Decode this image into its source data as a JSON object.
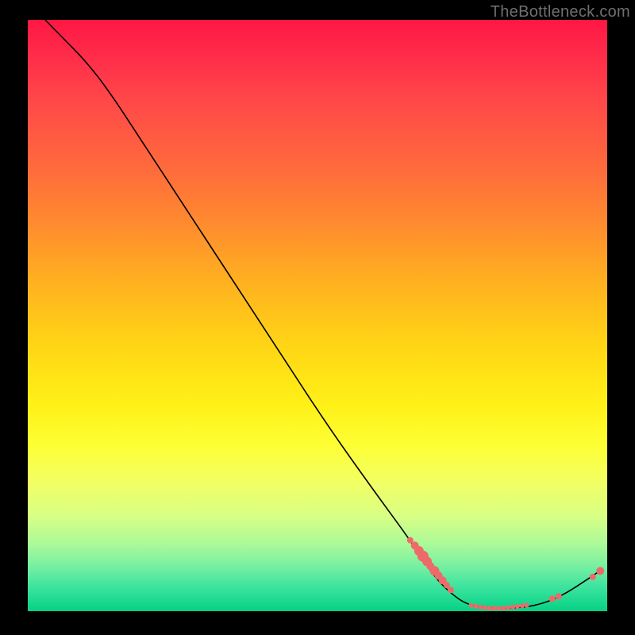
{
  "watermark": "TheBottleneck.com",
  "colors": {
    "background": "#000000",
    "curve": "#000000",
    "dot": "#ee6a6a",
    "watermark": "#6f6f6f",
    "gradient_top": "#ff1744",
    "gradient_mid": "#fff017",
    "gradient_bottom": "#08cf84"
  },
  "chart_data": {
    "type": "line",
    "title": "",
    "xlabel": "",
    "ylabel": "",
    "xlim": [
      0,
      100
    ],
    "ylim": [
      0,
      100
    ],
    "legend": false,
    "grid": false,
    "note": "Y axis is inverted visually: high value = high bottleneck = red top; minimum sits near bottom-right before rising again.",
    "curve_points": [
      {
        "x": 3,
        "y": 100
      },
      {
        "x": 6,
        "y": 97
      },
      {
        "x": 10,
        "y": 93
      },
      {
        "x": 14,
        "y": 88
      },
      {
        "x": 20,
        "y": 79
      },
      {
        "x": 28,
        "y": 67
      },
      {
        "x": 36,
        "y": 55
      },
      {
        "x": 44,
        "y": 43
      },
      {
        "x": 52,
        "y": 31
      },
      {
        "x": 60,
        "y": 20
      },
      {
        "x": 66,
        "y": 12
      },
      {
        "x": 70,
        "y": 6
      },
      {
        "x": 73,
        "y": 3
      },
      {
        "x": 76,
        "y": 1
      },
      {
        "x": 80,
        "y": 0.5
      },
      {
        "x": 84,
        "y": 0.5
      },
      {
        "x": 88,
        "y": 1
      },
      {
        "x": 92,
        "y": 2.5
      },
      {
        "x": 96,
        "y": 5
      },
      {
        "x": 99,
        "y": 7
      }
    ],
    "highlight_clusters": [
      {
        "range_x": [
          66,
          73
        ],
        "style": "dense-dots"
      },
      {
        "range_x": [
          76,
          86
        ],
        "style": "dense-dots"
      },
      {
        "range_x": [
          90,
          92
        ],
        "style": "sparse-dots"
      },
      {
        "range_x": [
          97,
          99
        ],
        "style": "sparse-dots"
      }
    ],
    "highlight_dots": [
      {
        "x": 66.0,
        "y": 12.0,
        "r": 4
      },
      {
        "x": 66.8,
        "y": 11.1,
        "r": 5
      },
      {
        "x": 67.5,
        "y": 10.2,
        "r": 6
      },
      {
        "x": 68.2,
        "y": 9.3,
        "r": 7
      },
      {
        "x": 68.9,
        "y": 8.4,
        "r": 6
      },
      {
        "x": 69.5,
        "y": 7.6,
        "r": 5
      },
      {
        "x": 70.2,
        "y": 6.8,
        "r": 6
      },
      {
        "x": 70.9,
        "y": 6.0,
        "r": 5
      },
      {
        "x": 71.6,
        "y": 5.2,
        "r": 5
      },
      {
        "x": 72.3,
        "y": 4.4,
        "r": 4
      },
      {
        "x": 73.0,
        "y": 3.6,
        "r": 4
      },
      {
        "x": 76.5,
        "y": 1.0,
        "r": 3
      },
      {
        "x": 77.3,
        "y": 0.8,
        "r": 3
      },
      {
        "x": 78.1,
        "y": 0.7,
        "r": 3
      },
      {
        "x": 78.9,
        "y": 0.6,
        "r": 3
      },
      {
        "x": 79.7,
        "y": 0.5,
        "r": 3
      },
      {
        "x": 80.5,
        "y": 0.5,
        "r": 3
      },
      {
        "x": 81.3,
        "y": 0.5,
        "r": 3
      },
      {
        "x": 82.1,
        "y": 0.5,
        "r": 3
      },
      {
        "x": 82.9,
        "y": 0.6,
        "r": 3
      },
      {
        "x": 83.7,
        "y": 0.7,
        "r": 3
      },
      {
        "x": 84.5,
        "y": 0.8,
        "r": 3
      },
      {
        "x": 85.3,
        "y": 0.9,
        "r": 3
      },
      {
        "x": 86.1,
        "y": 1.0,
        "r": 3
      },
      {
        "x": 90.5,
        "y": 2.1,
        "r": 4
      },
      {
        "x": 91.6,
        "y": 2.5,
        "r": 4
      },
      {
        "x": 97.5,
        "y": 5.8,
        "r": 4
      },
      {
        "x": 98.8,
        "y": 6.8,
        "r": 5
      }
    ]
  }
}
